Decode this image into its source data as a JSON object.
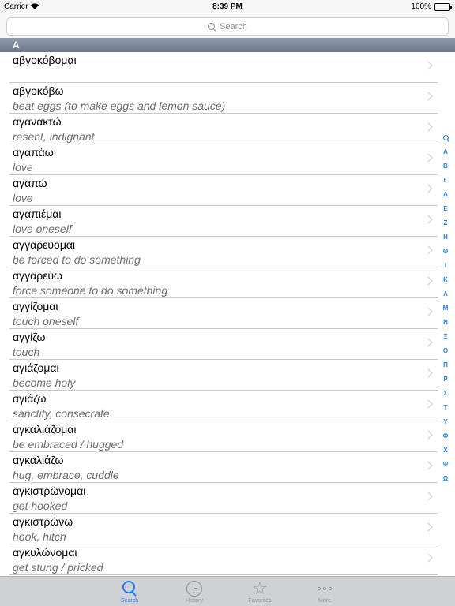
{
  "status": {
    "carrier": "Carrier",
    "time": "8:39 PM",
    "battery": "100%",
    "battery_level": 1.0
  },
  "search": {
    "placeholder": "Search"
  },
  "section": "A",
  "entries": [
    {
      "word": "αβγοκόβομαι",
      "def": ""
    },
    {
      "word": "αβγοκόβω",
      "def": "beat eggs (to make eggs and lemon sauce)"
    },
    {
      "word": "αγανακτώ",
      "def": "resent, indignant"
    },
    {
      "word": "αγαπάω",
      "def": "love"
    },
    {
      "word": "αγαπώ",
      "def": "love"
    },
    {
      "word": "αγαπιέμαι",
      "def": "love oneself"
    },
    {
      "word": "αγγαρεύομαι",
      "def": "be forced to do something"
    },
    {
      "word": "αγγαρεύω",
      "def": "force someone to do something"
    },
    {
      "word": "αγγίζομαι",
      "def": "touch oneself"
    },
    {
      "word": "αγγίζω",
      "def": "touch"
    },
    {
      "word": "αγιάζομαι",
      "def": "become holy"
    },
    {
      "word": "αγιάζω",
      "def": "sanctify, consecrate"
    },
    {
      "word": "αγκαλιάζομαι",
      "def": "be embraced / hugged"
    },
    {
      "word": "αγκαλιάζω",
      "def": "hug, embrace, cuddle"
    },
    {
      "word": "αγκιστρώνομαι",
      "def": "get hooked"
    },
    {
      "word": "αγκιστρώνω",
      "def": "hook, hitch"
    },
    {
      "word": "αγκυλώνομαι",
      "def": "get stung / pricked"
    }
  ],
  "index": [
    "A",
    "B",
    "Γ",
    "Δ",
    "E",
    "Z",
    "H",
    "Θ",
    "I",
    "K",
    "Λ",
    "M",
    "N",
    "Ξ",
    "O",
    "Π",
    "P",
    "Σ",
    "T",
    "Y",
    "Φ",
    "X",
    "Ψ",
    "Ω"
  ],
  "tabs": [
    {
      "id": "search",
      "label": "Search",
      "icon": "search-icon"
    },
    {
      "id": "history",
      "label": "History",
      "icon": "clock-icon"
    },
    {
      "id": "favorites",
      "label": "Favorites",
      "icon": "star-icon"
    },
    {
      "id": "more",
      "label": "More",
      "icon": "more-dots-icon"
    }
  ],
  "colors": {
    "accent": "#1a7ff5",
    "section_header": "#7a8698",
    "definition": "#6d6d72",
    "tab_inactive": "#929292"
  }
}
